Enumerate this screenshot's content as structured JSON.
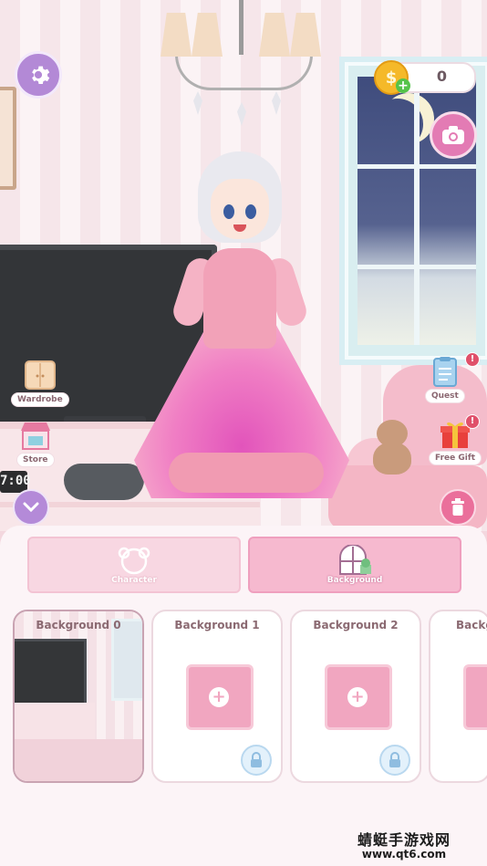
{
  "hud": {
    "coins": "0",
    "coin_symbol": "$",
    "coin_plus": "+",
    "clock_display": "7:00"
  },
  "left_menu": [
    {
      "label": "Wardrobe",
      "icon": "wardrobe-icon"
    },
    {
      "label": "Store",
      "icon": "store-icon"
    }
  ],
  "right_menu": [
    {
      "label": "Quest",
      "icon": "quest-clipboard-icon",
      "badge": "!"
    },
    {
      "label": "Free Gift",
      "icon": "gift-box-icon",
      "badge": "!"
    }
  ],
  "tabs": [
    {
      "label": "Character",
      "icon": "character-head-icon",
      "selected": false
    },
    {
      "label": "Background",
      "icon": "background-window-icon",
      "selected": true
    }
  ],
  "backgrounds": [
    {
      "title": "Background 0",
      "locked": false,
      "selected": true
    },
    {
      "title": "Background 1",
      "locked": true,
      "selected": false
    },
    {
      "title": "Background 2",
      "locked": true,
      "selected": false
    },
    {
      "title": "Backg",
      "locked": true,
      "selected": false
    }
  ],
  "watermark": {
    "line1": "蜻蜓手游戏网",
    "line2": "www.qt6.com"
  },
  "colors": {
    "accent_purple": "#b389d6",
    "accent_pink": "#ea6f9b",
    "coin_gold": "#f5b929",
    "tab_selected": "#f6b9cf"
  }
}
